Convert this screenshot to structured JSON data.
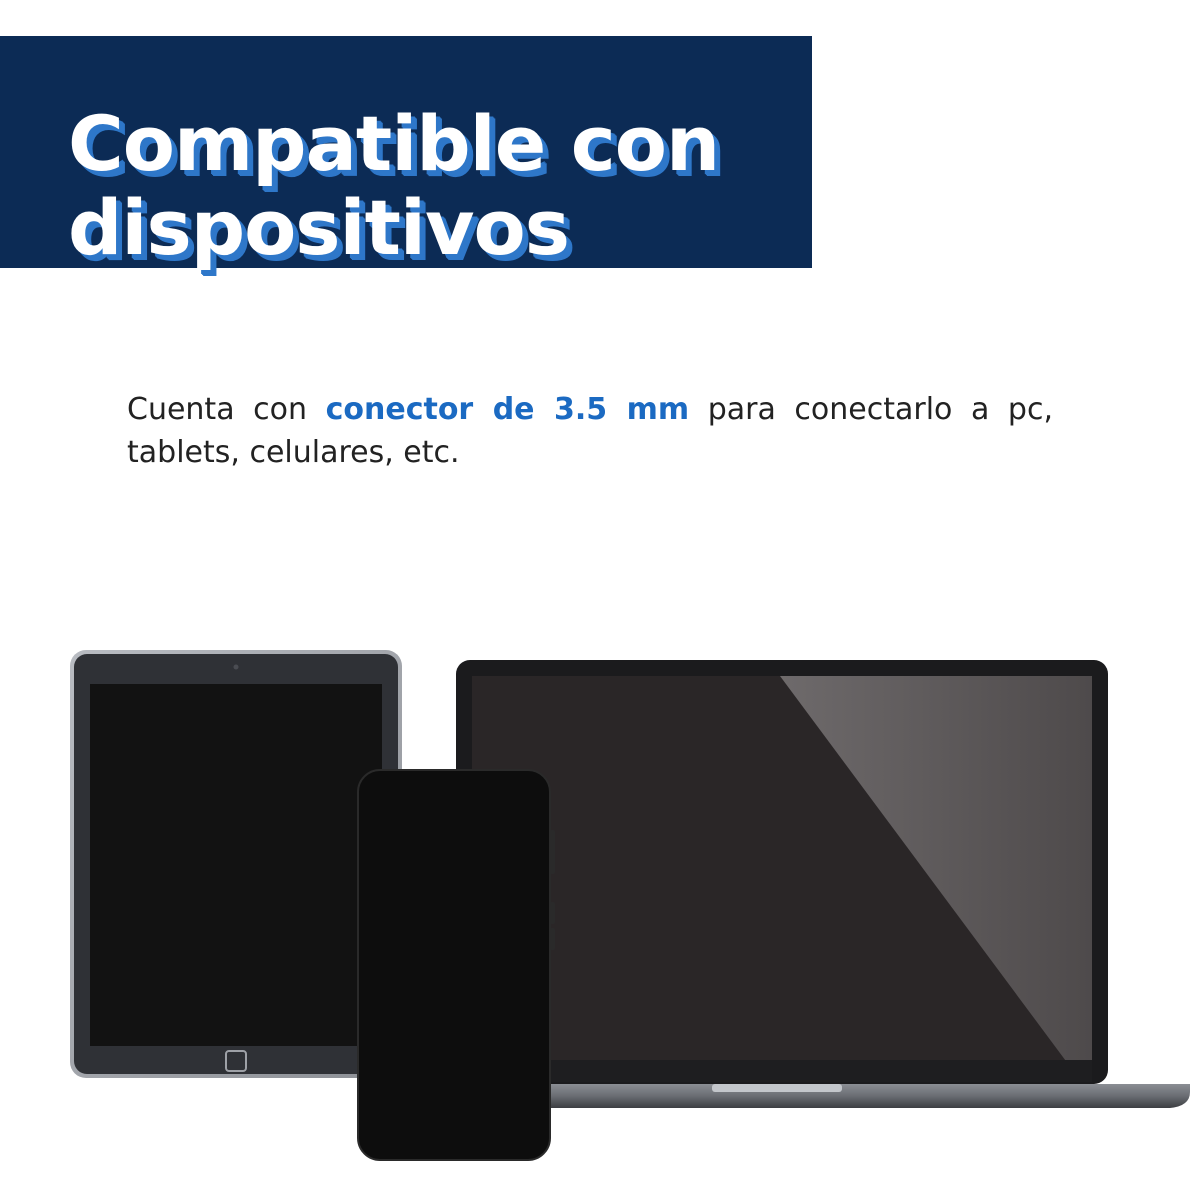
{
  "banner": {
    "title_line1": "Compatible con",
    "title_line2": "dispositivos",
    "background_color": "#0c2b55",
    "shadow_color": "#2e77c9"
  },
  "description": {
    "before": "Cuenta con ",
    "highlight": "conector de 3.5 mm",
    "after": " para conectarlo a pc, tablets, celulares, etc.",
    "highlight_color": "#1b6ac2"
  },
  "illustration": {
    "devices": [
      "tablet",
      "laptop",
      "smartphone"
    ]
  }
}
